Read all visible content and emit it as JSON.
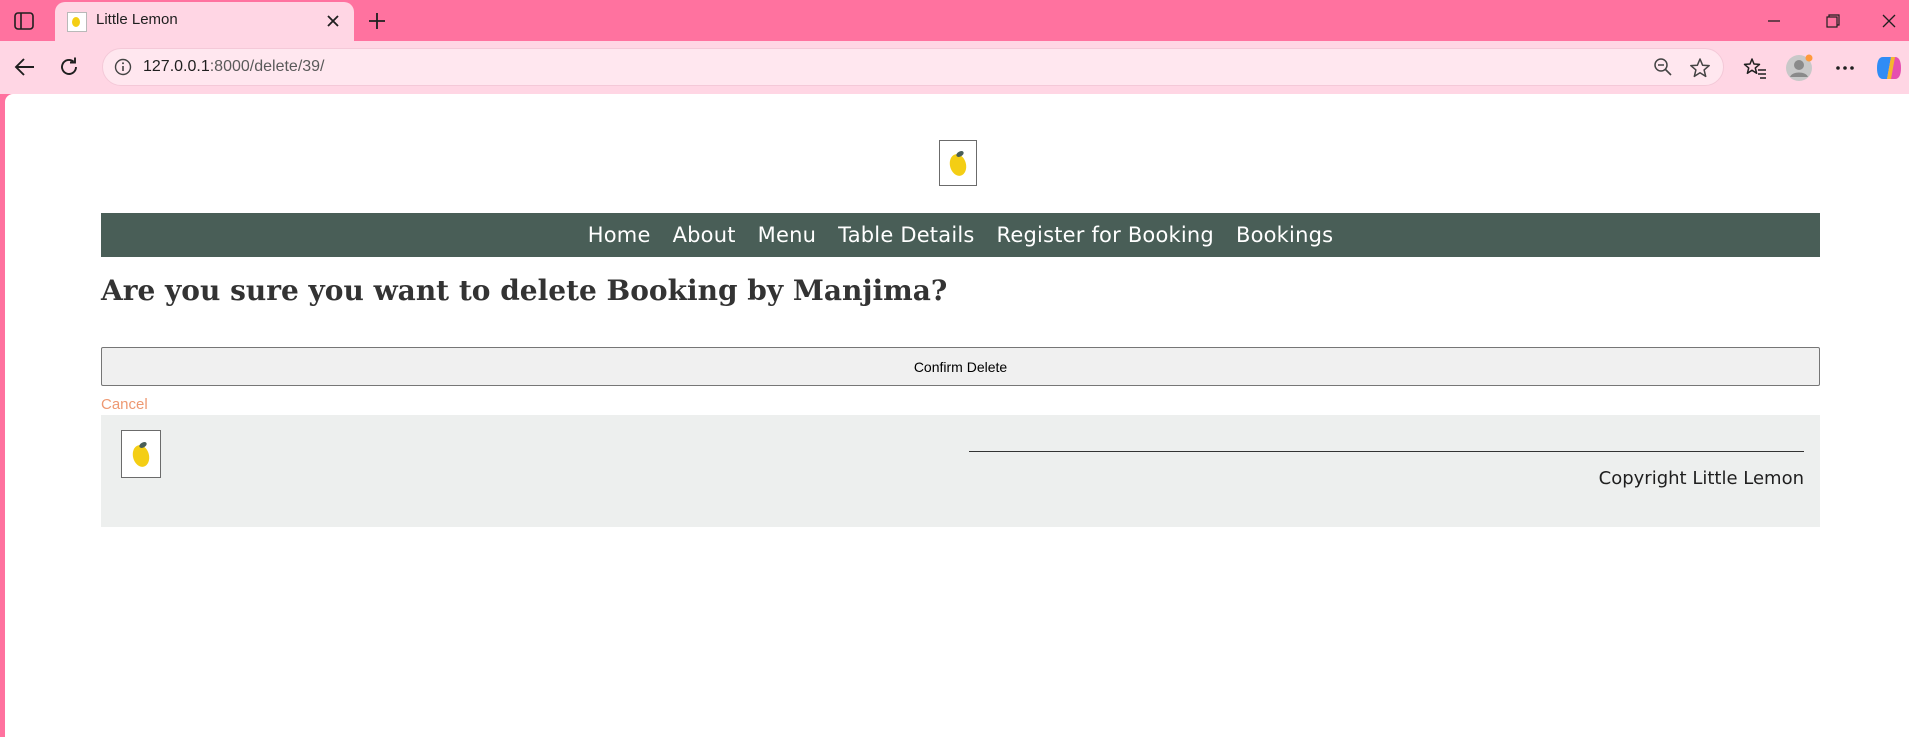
{
  "browser": {
    "tab_title": "Little Lemon",
    "url_host": "127.0.0.1",
    "url_rest": ":8000/delete/39/"
  },
  "site": {
    "nav": [
      "Home",
      "About",
      "Menu",
      "Table Details",
      "Register for Booking",
      "Bookings"
    ],
    "heading": "Are you sure you want to delete Booking by Manjima?",
    "confirm_label": "Confirm Delete",
    "cancel_label": "Cancel",
    "copyright": "Copyright Little Lemon"
  },
  "colors": {
    "browser_frame": "#ff729f",
    "toolbar": "#ffd6e4",
    "nav_bg": "#495e57",
    "cancel_link": "#ee9972",
    "footer_bg": "#edefee",
    "lemon": "#f4ce14"
  }
}
